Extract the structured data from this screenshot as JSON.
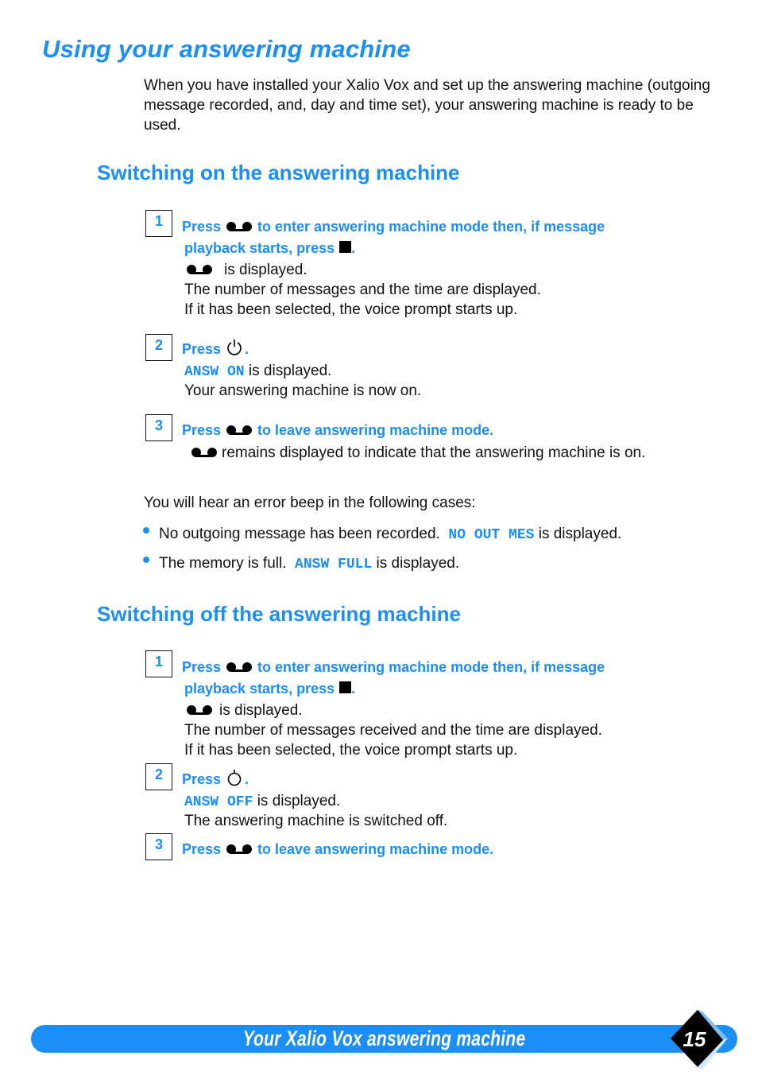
{
  "page": {
    "title": "Using your answering machine",
    "intro": "When you have installed your Xalio Vox and set up the answering machine (outgoing message recorded, and, day and time set), your answering machine is ready to be used.",
    "accent_color": "#1b8ef8"
  },
  "switch_on": {
    "heading": "Switching on the answering machine",
    "steps": [
      {
        "number": "1",
        "instr_a": "Press",
        "instr_b": "to enter answering machine mode then, if message",
        "instr_c": "playback starts, press",
        "instr_end": ".",
        "line1": "is displayed.",
        "line2": "The number of messages and the time are displayed.",
        "line3": "If it has been selected, the voice prompt starts up."
      },
      {
        "number": "2",
        "instr_a": "Press",
        "instr_end": ".",
        "lcd": "ANSW ON",
        "line1": " is displayed.",
        "line2": "Your answering machine is now on."
      },
      {
        "number": "3",
        "instr_a": "Press",
        "instr_b": "to leave answering machine mode.",
        "line1": "remains displayed to indicate that the answering machine is on."
      }
    ]
  },
  "errors": {
    "intro": "You will hear an error beep in the following cases:",
    "items": [
      {
        "text": "No outgoing message has been recorded.",
        "lcd": "NO OUT MES",
        "suffix": " is displayed."
      },
      {
        "text": "The memory is full.",
        "lcd": "ANSW FULL",
        "suffix": " is displayed."
      }
    ]
  },
  "switch_off": {
    "heading": "Switching off the answering machine",
    "steps": [
      {
        "number": "1",
        "instr_a": "Press",
        "instr_b": "to enter answering machine mode then, if message",
        "instr_c": "playback starts, press",
        "instr_end": ".",
        "line1": "is displayed.",
        "line2": "The number of messages received and the time are displayed.",
        "line3": "If it has been selected, the voice prompt starts up."
      },
      {
        "number": "2",
        "instr_a": "Press",
        "instr_end": ".",
        "lcd": "ANSW OFF",
        "line1": " is displayed.",
        "line2": "The answering machine is switched off."
      },
      {
        "number": "3",
        "instr_a": "Press",
        "instr_b": "to leave answering machine mode."
      }
    ]
  },
  "footer": {
    "chapter_title": "Your Xalio Vox answering machine",
    "page_number": "15"
  }
}
